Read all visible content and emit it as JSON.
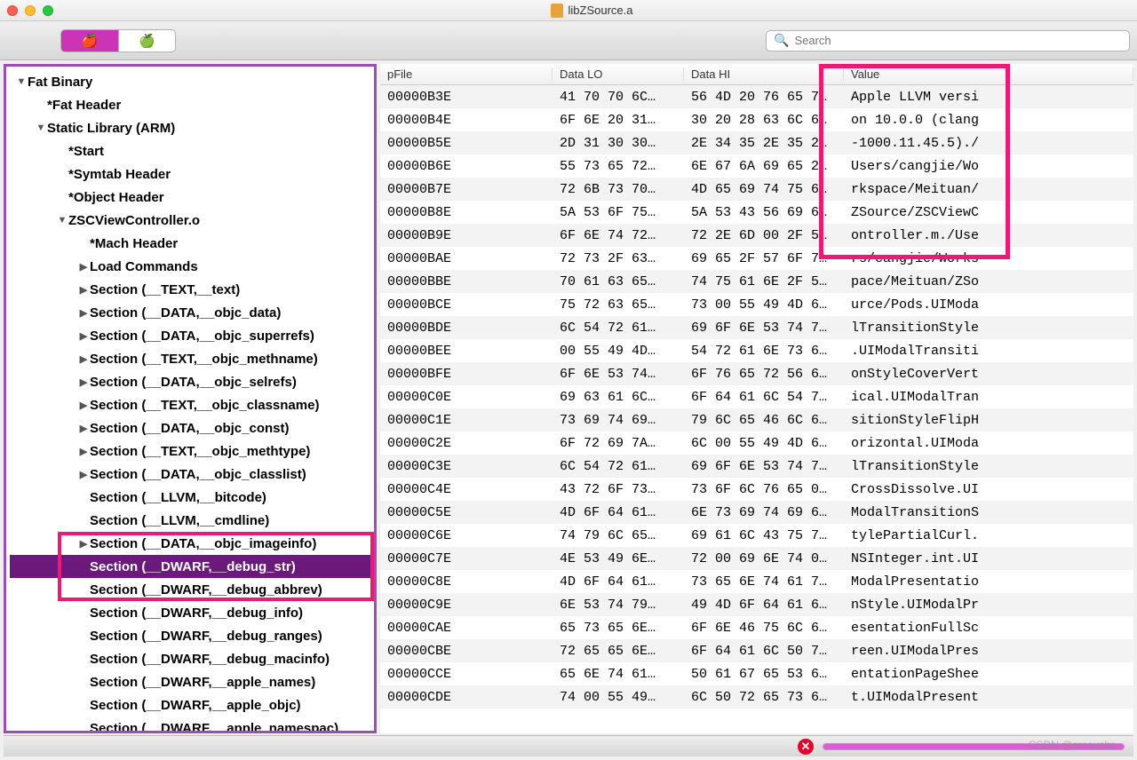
{
  "window": {
    "title": "libZSource.a"
  },
  "toolbar": {
    "search_placeholder": "Search"
  },
  "tree": [
    {
      "label": "Fat Binary",
      "indent": 0,
      "arrow": "▼"
    },
    {
      "label": "*Fat Header",
      "indent": 1,
      "arrow": ""
    },
    {
      "label": "Static Library (ARM)",
      "indent": 1,
      "arrow": "▼"
    },
    {
      "label": "*Start",
      "indent": 2,
      "arrow": ""
    },
    {
      "label": "*Symtab Header",
      "indent": 2,
      "arrow": ""
    },
    {
      "label": "*Object Header",
      "indent": 2,
      "arrow": ""
    },
    {
      "label": "ZSCViewController.o",
      "indent": 2,
      "arrow": "▼"
    },
    {
      "label": "*Mach Header",
      "indent": 3,
      "arrow": ""
    },
    {
      "label": "Load Commands",
      "indent": 3,
      "arrow": "▶"
    },
    {
      "label": "Section (__TEXT,__text)",
      "indent": 3,
      "arrow": "▶"
    },
    {
      "label": "Section (__DATA,__objc_data)",
      "indent": 3,
      "arrow": "▶"
    },
    {
      "label": "Section (__DATA,__objc_superrefs)",
      "indent": 3,
      "arrow": "▶"
    },
    {
      "label": "Section (__TEXT,__objc_methname)",
      "indent": 3,
      "arrow": "▶"
    },
    {
      "label": "Section (__DATA,__objc_selrefs)",
      "indent": 3,
      "arrow": "▶"
    },
    {
      "label": "Section (__TEXT,__objc_classname)",
      "indent": 3,
      "arrow": "▶"
    },
    {
      "label": "Section (__DATA,__objc_const)",
      "indent": 3,
      "arrow": "▶"
    },
    {
      "label": "Section (__TEXT,__objc_methtype)",
      "indent": 3,
      "arrow": "▶"
    },
    {
      "label": "Section (__DATA,__objc_classlist)",
      "indent": 3,
      "arrow": "▶"
    },
    {
      "label": "Section (__LLVM,__bitcode)",
      "indent": 3,
      "arrow": ""
    },
    {
      "label": "Section (__LLVM,__cmdline)",
      "indent": 3,
      "arrow": ""
    },
    {
      "label": "Section (__DATA,__objc_imageinfo)",
      "indent": 3,
      "arrow": "▶"
    },
    {
      "label": "Section (__DWARF,__debug_str)",
      "indent": 3,
      "arrow": "",
      "selected": true
    },
    {
      "label": "Section (__DWARF,__debug_abbrev)",
      "indent": 3,
      "arrow": ""
    },
    {
      "label": "Section (__DWARF,__debug_info)",
      "indent": 3,
      "arrow": ""
    },
    {
      "label": "Section (__DWARF,__debug_ranges)",
      "indent": 3,
      "arrow": ""
    },
    {
      "label": "Section (__DWARF,__debug_macinfo)",
      "indent": 3,
      "arrow": ""
    },
    {
      "label": "Section (__DWARF,__apple_names)",
      "indent": 3,
      "arrow": ""
    },
    {
      "label": "Section (__DWARF,__apple_objc)",
      "indent": 3,
      "arrow": ""
    },
    {
      "label": "Section (__DWARF,__apple_namespac)",
      "indent": 3,
      "arrow": ""
    }
  ],
  "table": {
    "headers": {
      "c1": "pFile",
      "c2": "Data LO",
      "c3": "Data HI",
      "c4": "Value"
    },
    "rows": [
      {
        "pfile": "00000B3E",
        "lo": "41 70 70 6C…",
        "hi": "56 4D 20 76 65 7…",
        "val": "Apple LLVM versi"
      },
      {
        "pfile": "00000B4E",
        "lo": "6F 6E 20 31…",
        "hi": "30 20 28 63 6C 6…",
        "val": "on 10.0.0 (clang"
      },
      {
        "pfile": "00000B5E",
        "lo": "2D 31 30 30…",
        "hi": "2E 34 35 2E 35 2…",
        "val": "-1000.11.45.5)./"
      },
      {
        "pfile": "00000B6E",
        "lo": "55 73 65 72…",
        "hi": "6E 67 6A 69 65 2…",
        "val": "Users/cangjie/Wo"
      },
      {
        "pfile": "00000B7E",
        "lo": "72 6B 73 70…",
        "hi": "4D 65 69 74 75 6…",
        "val": "rkspace/Meituan/"
      },
      {
        "pfile": "00000B8E",
        "lo": "5A 53 6F 75…",
        "hi": "5A 53 43 56 69 6…",
        "val": "ZSource/ZSCViewC"
      },
      {
        "pfile": "00000B9E",
        "lo": "6F 6E 74 72…",
        "hi": "72 2E 6D 00 2F 5…",
        "val": "ontroller.m./Use"
      },
      {
        "pfile": "00000BAE",
        "lo": "72 73 2F 63…",
        "hi": "69 65 2F 57 6F 7…",
        "val": "rs/cangjie/Works"
      },
      {
        "pfile": "00000BBE",
        "lo": "70 61 63 65…",
        "hi": "74 75 61 6E 2F 5…",
        "val": "pace/Meituan/ZSo"
      },
      {
        "pfile": "00000BCE",
        "lo": "75 72 63 65…",
        "hi": "73 00 55 49 4D 6…",
        "val": "urce/Pods.UIModa"
      },
      {
        "pfile": "00000BDE",
        "lo": "6C 54 72 61…",
        "hi": "69 6F 6E 53 74 7…",
        "val": "lTransitionStyle"
      },
      {
        "pfile": "00000BEE",
        "lo": "00 55 49 4D…",
        "hi": "54 72 61 6E 73 6…",
        "val": ".UIModalTransiti"
      },
      {
        "pfile": "00000BFE",
        "lo": "6F 6E 53 74…",
        "hi": "6F 76 65 72 56 6…",
        "val": "onStyleCoverVert"
      },
      {
        "pfile": "00000C0E",
        "lo": "69 63 61 6C…",
        "hi": "6F 64 61 6C 54 7…",
        "val": "ical.UIModalTran"
      },
      {
        "pfile": "00000C1E",
        "lo": "73 69 74 69…",
        "hi": "79 6C 65 46 6C 6…",
        "val": "sitionStyleFlipH"
      },
      {
        "pfile": "00000C2E",
        "lo": "6F 72 69 7A…",
        "hi": "6C 00 55 49 4D 6…",
        "val": "orizontal.UIModa"
      },
      {
        "pfile": "00000C3E",
        "lo": "6C 54 72 61…",
        "hi": "69 6F 6E 53 74 7…",
        "val": "lTransitionStyle"
      },
      {
        "pfile": "00000C4E",
        "lo": "43 72 6F 73…",
        "hi": "73 6F 6C 76 65 0…",
        "val": "CrossDissolve.UI"
      },
      {
        "pfile": "00000C5E",
        "lo": "4D 6F 64 61…",
        "hi": "6E 73 69 74 69 6…",
        "val": "ModalTransitionS"
      },
      {
        "pfile": "00000C6E",
        "lo": "74 79 6C 65…",
        "hi": "69 61 6C 43 75 7…",
        "val": "tylePartialCurl."
      },
      {
        "pfile": "00000C7E",
        "lo": "4E 53 49 6E…",
        "hi": "72 00 69 6E 74 0…",
        "val": "NSInteger.int.UI"
      },
      {
        "pfile": "00000C8E",
        "lo": "4D 6F 64 61…",
        "hi": "73 65 6E 74 61 7…",
        "val": "ModalPresentatio"
      },
      {
        "pfile": "00000C9E",
        "lo": "6E 53 74 79…",
        "hi": "49 4D 6F 64 61 6…",
        "val": "nStyle.UIModalPr"
      },
      {
        "pfile": "00000CAE",
        "lo": "65 73 65 6E…",
        "hi": "6F 6E 46 75 6C 6…",
        "val": "esentationFullSc"
      },
      {
        "pfile": "00000CBE",
        "lo": "72 65 65 6E…",
        "hi": "6F 64 61 6C 50 7…",
        "val": "reen.UIModalPres"
      },
      {
        "pfile": "00000CCE",
        "lo": "65 6E 74 61…",
        "hi": "50 61 67 65 53 6…",
        "val": "entationPageShee"
      },
      {
        "pfile": "00000CDE",
        "lo": "74 00 55 49…",
        "hi": "6C 50 72 65 73 6…",
        "val": "t.UIModalPresent"
      }
    ]
  },
  "watermark": "CSDN @arceushs"
}
